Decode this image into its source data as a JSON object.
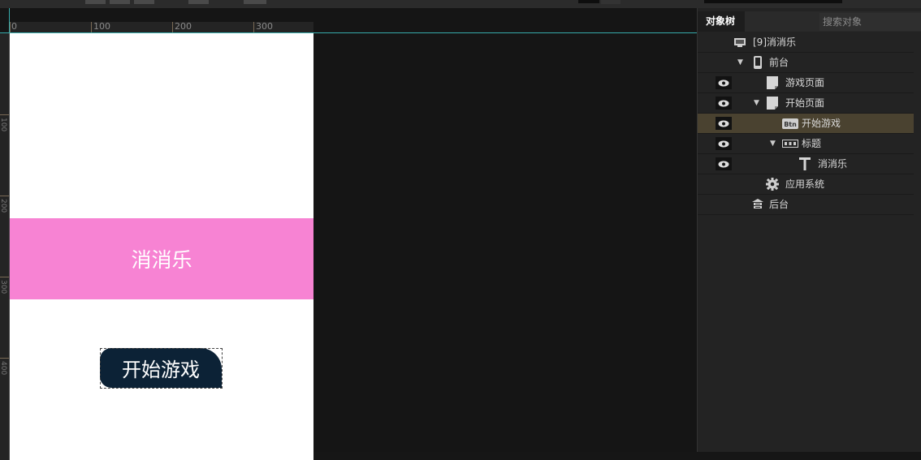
{
  "canvas": {
    "ruler_labels": [
      "0",
      "100",
      "200",
      "300"
    ],
    "ruler_left_labels": [
      "100",
      "200",
      "300",
      "400"
    ],
    "title_text": "消消乐",
    "button_text": "开始游戏",
    "title_color": "#f783d3",
    "button_color": "#0c2236"
  },
  "panel": {
    "tab_label": "对象树",
    "search_placeholder": "搜索对象",
    "tree": [
      {
        "label": "[9]消消乐",
        "icon": "project-icon"
      },
      {
        "label": "前台",
        "icon": "phone-icon"
      },
      {
        "label": "游戏页面",
        "icon": "page-icon"
      },
      {
        "label": "开始页面",
        "icon": "page-icon"
      },
      {
        "label": "开始游戏",
        "icon": "button-icon"
      },
      {
        "label": "标题",
        "icon": "container-icon"
      },
      {
        "label": "消消乐",
        "icon": "text-icon"
      },
      {
        "label": "应用系统",
        "icon": "gear-icon"
      },
      {
        "label": "后台",
        "icon": "server-icon"
      }
    ]
  }
}
